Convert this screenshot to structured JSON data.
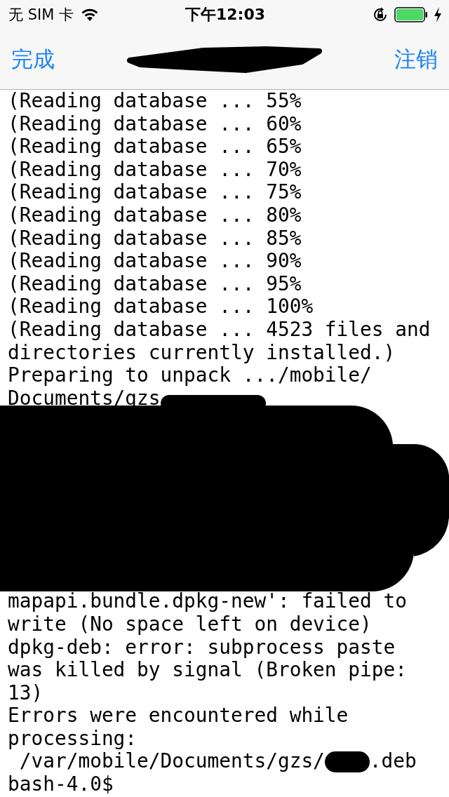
{
  "status_bar": {
    "carrier": "无 SIM 卡",
    "time": "下午12:03",
    "battery": {
      "level": 1,
      "charging": true
    }
  },
  "nav_bar": {
    "left_button": "完成",
    "title_redacted": true,
    "right_button": "注销"
  },
  "terminal": {
    "lines": [
      {
        "kind": "text",
        "text": "(Reading database ... 55%"
      },
      {
        "kind": "text",
        "text": "(Reading database ... 60%"
      },
      {
        "kind": "text",
        "text": "(Reading database ... 65%"
      },
      {
        "kind": "text",
        "text": "(Reading database ... 70%"
      },
      {
        "kind": "text",
        "text": "(Reading database ... 75%"
      },
      {
        "kind": "text",
        "text": "(Reading database ... 80%"
      },
      {
        "kind": "text",
        "text": "(Reading database ... 85%"
      },
      {
        "kind": "text",
        "text": "(Reading database ... 90%"
      },
      {
        "kind": "text",
        "text": "(Reading database ... 95%"
      },
      {
        "kind": "text",
        "text": "(Reading database ... 100%"
      },
      {
        "kind": "text",
        "text": "(Reading database ... 4523 files and"
      },
      {
        "kind": "text",
        "text": "directories currently installed.)"
      },
      {
        "kind": "text",
        "text": "Preparing to unpack .../mobile/"
      },
      {
        "kind": "split",
        "before": "Documents/gzs"
      },
      {
        "kind": "redacted"
      },
      {
        "kind": "text",
        "text": "mapapi.bundle.dpkg-new': failed to"
      },
      {
        "kind": "text",
        "text": "write (No space left on device)"
      },
      {
        "kind": "text",
        "text": "dpkg-deb: error: subprocess paste"
      },
      {
        "kind": "text",
        "text": "was killed by signal (Broken pipe:"
      },
      {
        "kind": "text",
        "text": "13)"
      },
      {
        "kind": "text",
        "text": "Errors were encountered while"
      },
      {
        "kind": "text",
        "text": "processing:"
      },
      {
        "kind": "split",
        "before": " /var/mobile/Documents/gzs/",
        "after": ".deb"
      },
      {
        "kind": "text",
        "text": "bash-4.0$"
      }
    ]
  }
}
